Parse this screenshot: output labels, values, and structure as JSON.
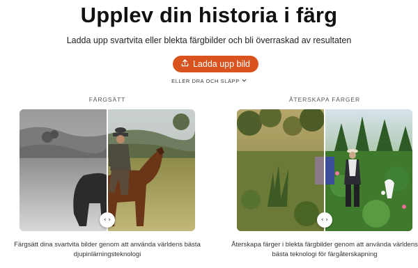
{
  "hero": {
    "title": "Upplev din historia i färg",
    "subtitle": "Ladda upp svartvita eller blekta färgbilder och bli överraskad av resultaten",
    "upload_label": "Ladda upp bild",
    "drop_label": "ELLER DRA OCH SLÄPP",
    "accent_color": "#d9531e"
  },
  "sections": [
    {
      "label": "FÄRGSÄTT",
      "caption": "Färgsätt dina svartvita bilder genom att använda världens bästa djupinlärningsteknologi",
      "handle_glyph": "‹ ›"
    },
    {
      "label": "ÅTERSKAPA FÄRGER",
      "caption": "Återskapa färger i blekta färgbilder genom att använda världens bästa teknologi för färgåterskapning",
      "handle_glyph": "‹ ›"
    }
  ],
  "icons": {
    "upload": "upload-icon",
    "chevron": "chevron-down-icon",
    "handle": "compare-handle-icon"
  }
}
